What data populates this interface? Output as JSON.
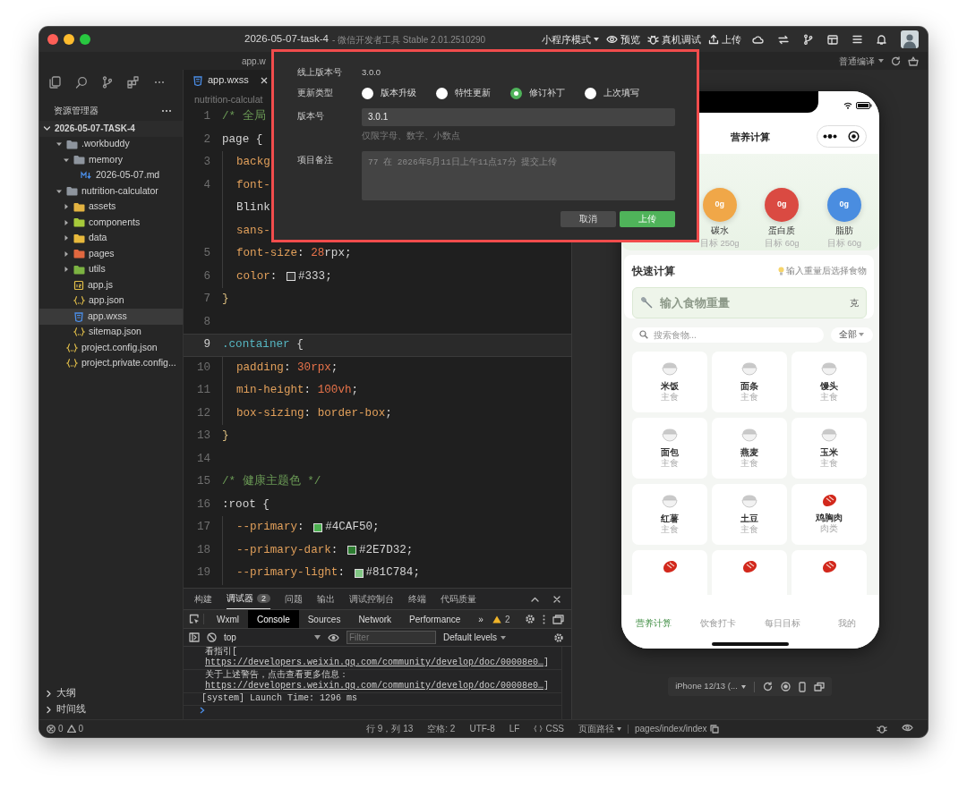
{
  "window": {
    "title": "2026-05-07-task-4",
    "subtitle": "- 微信开发者工具 Stable 2.01.2510290"
  },
  "toolbar": {
    "mode": "小程序模式",
    "actions": [
      {
        "label": "预览",
        "kind": "preview"
      },
      {
        "label": "真机调试",
        "kind": "debug"
      },
      {
        "label": "上传",
        "kind": "upload"
      }
    ]
  },
  "subbar": {
    "file": "app.w",
    "compile": "普通编译"
  },
  "sidebar": {
    "title": "资源管理器",
    "tree": [
      {
        "name": "2026-05-07-TASK-4",
        "kind": "root",
        "expanded": true,
        "selected": false,
        "children": [
          {
            "name": ".workbuddy",
            "kind": "folder",
            "color": "#8e959e",
            "expanded": true,
            "selected": false,
            "children": [
              {
                "name": "memory",
                "kind": "folder",
                "color": "#8e959e",
                "expanded": true,
                "selected": false,
                "children": [
                  {
                    "name": "2026-05-07.md",
                    "kind": "md",
                    "selected": false
                  }
                ]
              }
            ]
          },
          {
            "name": "nutrition-calculator",
            "kind": "folder",
            "color": "#8e959e",
            "expanded": true,
            "selected": false,
            "children": [
              {
                "name": "assets",
                "kind": "folder",
                "color": "#e3b341",
                "expanded": false,
                "selected": false
              },
              {
                "name": "components",
                "kind": "folder",
                "color": "#a6c93a",
                "expanded": false,
                "selected": false
              },
              {
                "name": "data",
                "kind": "folder",
                "color": "#e8b93c",
                "expanded": false,
                "selected": false
              },
              {
                "name": "pages",
                "kind": "folder",
                "color": "#e0673f",
                "expanded": false,
                "selected": false
              },
              {
                "name": "utils",
                "kind": "folder",
                "color": "#7cb342",
                "expanded": false,
                "selected": false
              },
              {
                "name": "app.js",
                "kind": "js",
                "selected": false
              },
              {
                "name": "app.json",
                "kind": "json",
                "selected": false
              },
              {
                "name": "app.wxss",
                "kind": "wxss",
                "selected": true
              },
              {
                "name": "sitemap.json",
                "kind": "json",
                "selected": false
              }
            ]
          },
          {
            "name": "project.config.json",
            "kind": "json",
            "selected": false
          },
          {
            "name": "project.private.config...",
            "kind": "json",
            "selected": false
          }
        ]
      }
    ],
    "panels": [
      {
        "label": "大纲",
        "expanded": false
      },
      {
        "label": "时间线",
        "expanded": false
      }
    ]
  },
  "editor": {
    "tabs": [
      {
        "label": "app.wxss",
        "selected": true
      }
    ],
    "breadcrumb": "nutrition-calculat",
    "lines": [
      {
        "number": "1",
        "indented": false,
        "current": false,
        "tokens": [
          {
            "text": "/* 全局",
            "kind": "comment"
          }
        ]
      },
      {
        "number": "2",
        "indented": false,
        "current": false,
        "tokens": [
          {
            "text": "page {",
            "kind": "plain"
          }
        ]
      },
      {
        "number": "3",
        "indented": true,
        "current": false,
        "tokens": [
          {
            "text": "backg",
            "kind": "prop"
          }
        ]
      },
      {
        "number": "4",
        "indented": true,
        "current": false,
        "tokens": [
          {
            "text": "font-",
            "kind": "prop"
          }
        ]
      },
      {
        "indented": true,
        "current": false,
        "tokens": [
          {
            "text": "Blink",
            "kind": "plain"
          }
        ]
      },
      {
        "indented": true,
        "current": false,
        "tokens": [
          {
            "text": "sans-",
            "kind": "prop"
          }
        ]
      },
      {
        "number": "5",
        "indented": true,
        "current": false,
        "tokens": [
          {
            "text": "font-size",
            "kind": "prop"
          },
          {
            "text": ": ",
            "kind": "plain"
          },
          {
            "text": "28",
            "kind": "num"
          },
          {
            "text": "rpx;",
            "kind": "plain"
          }
        ]
      },
      {
        "number": "6",
        "indented": true,
        "current": false,
        "tokens": [
          {
            "text": "color",
            "kind": "prop"
          },
          {
            "text": ": ",
            "kind": "plain"
          },
          {
            "kind": "swatch",
            "color": "#333333"
          },
          {
            "text": "#333;",
            "kind": "plain"
          }
        ]
      },
      {
        "number": "7",
        "indented": false,
        "current": false,
        "tokens": [
          {
            "text": "}",
            "kind": "brace"
          }
        ]
      },
      {
        "number": "8",
        "indented": false,
        "current": false
      },
      {
        "number": "9",
        "indented": false,
        "current": true,
        "tokens": [
          {
            "text": ".container",
            "kind": "class"
          },
          {
            "text": " {",
            "kind": "plain"
          }
        ]
      },
      {
        "number": "10",
        "indented": true,
        "current": false,
        "tokens": [
          {
            "text": "padding",
            "kind": "prop"
          },
          {
            "text": ": ",
            "kind": "plain"
          },
          {
            "text": "30rpx",
            "kind": "num"
          },
          {
            "text": ";",
            "kind": "plain"
          }
        ]
      },
      {
        "number": "11",
        "indented": true,
        "current": false,
        "tokens": [
          {
            "text": "min-height",
            "kind": "prop"
          },
          {
            "text": ": ",
            "kind": "plain"
          },
          {
            "text": "100vh",
            "kind": "num"
          },
          {
            "text": ";",
            "kind": "plain"
          }
        ]
      },
      {
        "number": "12",
        "indented": true,
        "current": false,
        "tokens": [
          {
            "text": "box-sizing",
            "kind": "prop"
          },
          {
            "text": ": ",
            "kind": "plain"
          },
          {
            "text": "border-box",
            "kind": "value"
          },
          {
            "text": ";",
            "kind": "plain"
          }
        ]
      },
      {
        "number": "13",
        "indented": false,
        "current": false,
        "tokens": [
          {
            "text": "}",
            "kind": "brace"
          }
        ]
      },
      {
        "number": "14",
        "indented": false,
        "current": false
      },
      {
        "number": "15",
        "indented": false,
        "current": false,
        "tokens": [
          {
            "text": "/* 健康主题色 */",
            "kind": "comment"
          }
        ]
      },
      {
        "number": "16",
        "indented": false,
        "current": false,
        "tokens": [
          {
            "text": ":root {",
            "kind": "plain"
          }
        ]
      },
      {
        "number": "17",
        "indented": true,
        "current": false,
        "tokens": [
          {
            "text": "--primary",
            "kind": "prop"
          },
          {
            "text": ": ",
            "kind": "plain"
          },
          {
            "kind": "swatch",
            "color": "#4caf50"
          },
          {
            "text": "#4CAF50;",
            "kind": "plain"
          }
        ]
      },
      {
        "number": "18",
        "indented": true,
        "current": false,
        "tokens": [
          {
            "text": "--primary-dark",
            "kind": "prop"
          },
          {
            "text": ": ",
            "kind": "plain"
          },
          {
            "kind": "swatch",
            "color": "#2e7d32"
          },
          {
            "text": "#2E7D32;",
            "kind": "plain"
          }
        ]
      },
      {
        "number": "19",
        "indented": true,
        "current": false,
        "tokens": [
          {
            "text": "--primary-light",
            "kind": "prop"
          },
          {
            "text": ": ",
            "kind": "plain"
          },
          {
            "kind": "swatch",
            "color": "#81c784"
          },
          {
            "text": "#81C784;",
            "kind": "plain"
          }
        ]
      }
    ]
  },
  "upload_dialog": {
    "online_version": {
      "label": "线上版本号",
      "value": "3.0.0"
    },
    "update_type": {
      "label": "更新类型",
      "options": [
        {
          "label": "版本升级",
          "selected": false
        },
        {
          "label": "特性更新",
          "selected": false
        },
        {
          "label": "修订补丁",
          "selected": true
        },
        {
          "label": "上次填写",
          "selected": false
        }
      ]
    },
    "version": {
      "label": "版本号",
      "value": "3.0.1",
      "hint": "仅限字母、数字、小数点"
    },
    "note": {
      "label": "项目备注",
      "placeholder": "77 在 2026年5月11日上午11点17分 提交上传"
    },
    "buttons": [
      {
        "label": "取消",
        "kind": "secondary"
      },
      {
        "label": "上传",
        "kind": "primary"
      }
    ]
  },
  "devtools": {
    "panel_tabs": [
      {
        "label": "构建",
        "selected": false
      },
      {
        "label": "调试器",
        "selected": true,
        "badge": "2"
      },
      {
        "label": "问题",
        "selected": false
      },
      {
        "label": "输出",
        "selected": false
      },
      {
        "label": "调试控制台",
        "selected": false
      },
      {
        "label": "终端",
        "selected": false
      },
      {
        "label": "代码质量",
        "selected": false
      }
    ],
    "tool_tabs": [
      {
        "label": "Wxml",
        "selected": false
      },
      {
        "label": "Console",
        "selected": true
      },
      {
        "label": "Sources",
        "selected": false
      },
      {
        "label": "Network",
        "selected": false
      },
      {
        "label": "Performance",
        "selected": false
      }
    ],
    "more": "»",
    "warnings": "2",
    "context": "top",
    "filter_placeholder": "Filter",
    "levels": "Default levels",
    "messages": [
      {
        "kind": "warning",
        "text": "看指引[",
        "link": "https://developers.weixin.qq.com/community/develop/doc/00008e0…",
        "end": "]"
      },
      {
        "kind": "warning",
        "text": "关于上述警告，点击查看更多信息：",
        "link": "https://developers.weixin.qq.com/community/develop/doc/00008e0…",
        "end": "]"
      },
      {
        "kind": "log",
        "text": "[system] Launch Time: 1296 ms"
      }
    ]
  },
  "simulator": {
    "nav_title": "营养计算",
    "macros": [
      {
        "value": "0g",
        "label": "碳水",
        "target": "目标 250g",
        "color": "#f0a748"
      },
      {
        "value": "0g",
        "label": "蛋白质",
        "target": "目标 60g",
        "color": "#da4a42"
      },
      {
        "value": "0g",
        "label": "脂肪",
        "target": "目标 60g",
        "color": "#4a8de0"
      }
    ],
    "quick_calc": {
      "title": "快速计算",
      "tip": "输入重量后选择食物",
      "placeholder": "输入食物重量",
      "unit": "克"
    },
    "search": {
      "placeholder": "搜索食物...",
      "filter": "全部"
    },
    "foods": [
      {
        "name": "米饭",
        "category": "主食",
        "kind": "grain"
      },
      {
        "name": "面条",
        "category": "主食",
        "kind": "grain"
      },
      {
        "name": "馒头",
        "category": "主食",
        "kind": "grain"
      },
      {
        "name": "面包",
        "category": "主食",
        "kind": "grain"
      },
      {
        "name": "燕麦",
        "category": "主食",
        "kind": "grain"
      },
      {
        "name": "玉米",
        "category": "主食",
        "kind": "grain"
      },
      {
        "name": "红薯",
        "category": "主食",
        "kind": "grain"
      },
      {
        "name": "土豆",
        "category": "主食",
        "kind": "grain"
      },
      {
        "name": "鸡胸肉",
        "category": "肉类",
        "kind": "meat"
      }
    ],
    "more_foods": [
      {
        "kind": "meat"
      },
      {
        "kind": "meat"
      },
      {
        "kind": "meat"
      }
    ],
    "tabbar": [
      {
        "label": "营养计算",
        "selected": true
      },
      {
        "label": "饮食打卡",
        "selected": false
      },
      {
        "label": "每日目标",
        "selected": false
      },
      {
        "label": "我的",
        "selected": false
      }
    ],
    "device": "iPhone 12/13 (..."
  },
  "status_bar": {
    "errors": "0",
    "warnings": "0",
    "position": "行 9，列 13",
    "indent": "空格: 2",
    "encoding": "UTF-8",
    "eol": "LF",
    "language": "CSS",
    "page_path_label": "页面路径",
    "page_path": "pages/index/index"
  }
}
